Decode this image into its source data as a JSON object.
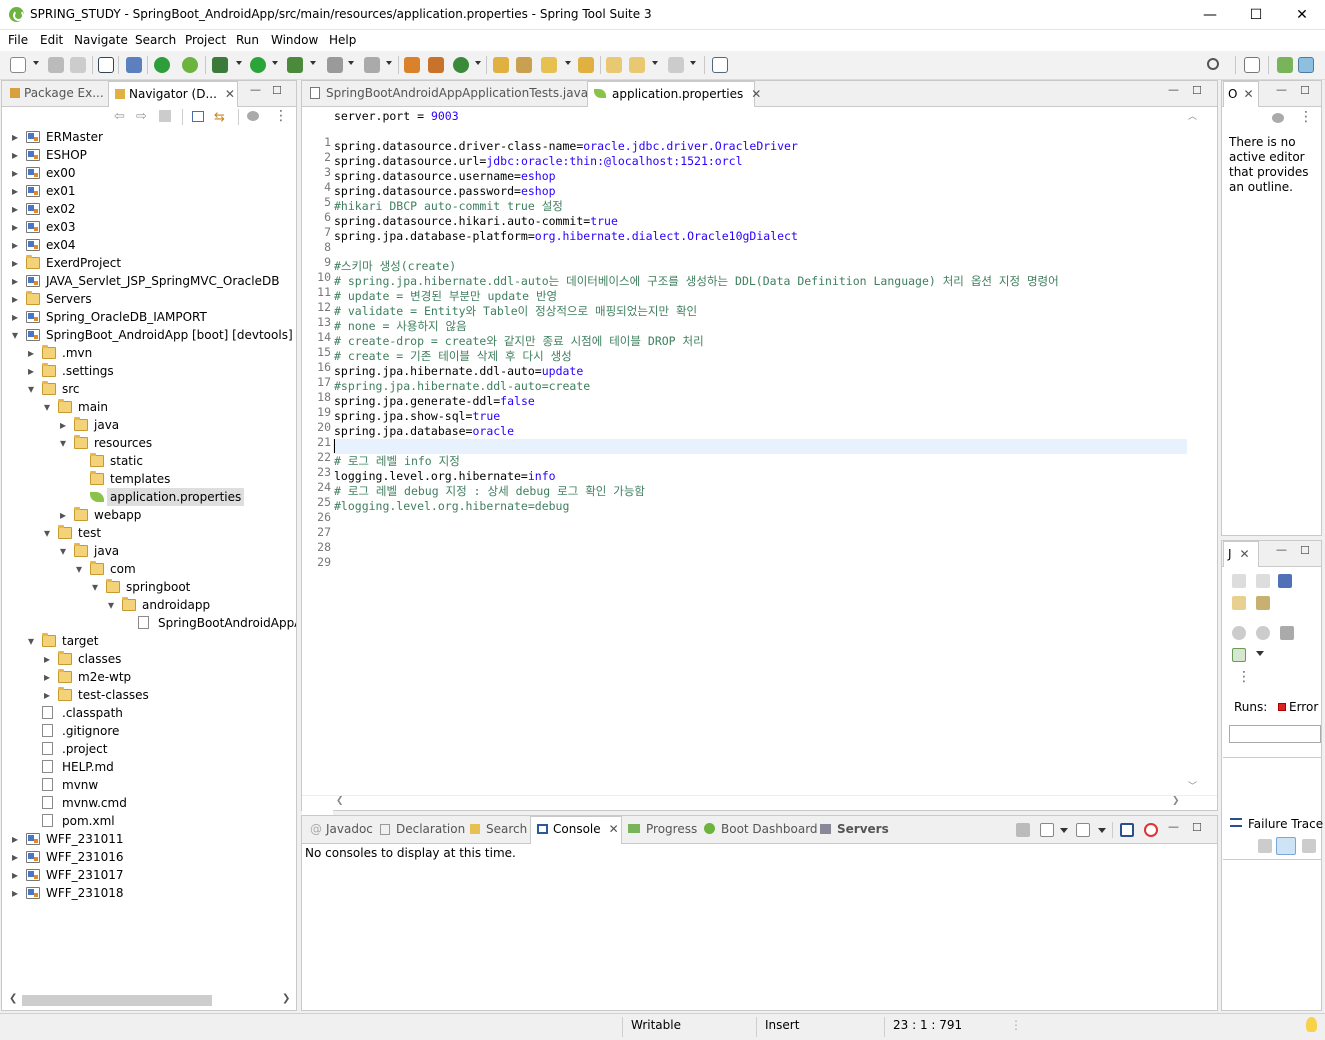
{
  "window": {
    "title": "SPRING_STUDY - SpringBoot_AndroidApp/src/main/resources/application.properties - Spring Tool Suite 3",
    "minimize": "—",
    "maximize": "☐",
    "close": "✕"
  },
  "menu": [
    "File",
    "Edit",
    "Navigate",
    "Search",
    "Project",
    "Run",
    "Window",
    "Help"
  ],
  "left_panel": {
    "tabs": [
      {
        "label": "Package Ex..."
      },
      {
        "label": "Navigator (D..."
      }
    ],
    "tree": [
      {
        "label": "ERMaster",
        "type": "project",
        "depth": 0,
        "toggle": "closed"
      },
      {
        "label": "ESHOP",
        "type": "project",
        "depth": 0,
        "toggle": "closed"
      },
      {
        "label": "ex00",
        "type": "project",
        "depth": 0,
        "toggle": "closed"
      },
      {
        "label": "ex01",
        "type": "project",
        "depth": 0,
        "toggle": "closed"
      },
      {
        "label": "ex02",
        "type": "project",
        "depth": 0,
        "toggle": "closed"
      },
      {
        "label": "ex03",
        "type": "project",
        "depth": 0,
        "toggle": "closed"
      },
      {
        "label": "ex04",
        "type": "project",
        "depth": 0,
        "toggle": "closed"
      },
      {
        "label": "ExerdProject",
        "type": "folder",
        "depth": 0,
        "toggle": "closed"
      },
      {
        "label": "JAVA_Servlet_JSP_SpringMVC_OracleDB",
        "type": "project",
        "depth": 0,
        "toggle": "closed"
      },
      {
        "label": "Servers",
        "type": "folder",
        "depth": 0,
        "toggle": "closed"
      },
      {
        "label": "Spring_OracleDB_IAMPORT",
        "type": "project",
        "depth": 0,
        "toggle": "closed"
      },
      {
        "label": "SpringBoot_AndroidApp [boot] [devtools]",
        "type": "project",
        "depth": 0,
        "toggle": "open"
      },
      {
        "label": ".mvn",
        "type": "folder",
        "depth": 1,
        "toggle": "closed"
      },
      {
        "label": ".settings",
        "type": "folder",
        "depth": 1,
        "toggle": "closed"
      },
      {
        "label": "src",
        "type": "folder",
        "depth": 1,
        "toggle": "open"
      },
      {
        "label": "main",
        "type": "folder",
        "depth": 2,
        "toggle": "open"
      },
      {
        "label": "java",
        "type": "folder",
        "depth": 3,
        "toggle": "closed"
      },
      {
        "label": "resources",
        "type": "folder",
        "depth": 3,
        "toggle": "open"
      },
      {
        "label": "static",
        "type": "folder",
        "depth": 4,
        "toggle": "none"
      },
      {
        "label": "templates",
        "type": "folder",
        "depth": 4,
        "toggle": "none"
      },
      {
        "label": "application.properties",
        "type": "spring",
        "depth": 4,
        "toggle": "none",
        "selected": true
      },
      {
        "label": "webapp",
        "type": "folder",
        "depth": 3,
        "toggle": "closed"
      },
      {
        "label": "test",
        "type": "folder",
        "depth": 2,
        "toggle": "open"
      },
      {
        "label": "java",
        "type": "folder",
        "depth": 3,
        "toggle": "open"
      },
      {
        "label": "com",
        "type": "folder",
        "depth": 4,
        "toggle": "open"
      },
      {
        "label": "springboot",
        "type": "folder",
        "depth": 5,
        "toggle": "open"
      },
      {
        "label": "androidapp",
        "type": "folder",
        "depth": 6,
        "toggle": "open"
      },
      {
        "label": "SpringBootAndroidAppAp",
        "type": "file",
        "depth": 7,
        "toggle": "none"
      },
      {
        "label": "target",
        "type": "folder",
        "depth": 1,
        "toggle": "open"
      },
      {
        "label": "classes",
        "type": "folder",
        "depth": 2,
        "toggle": "closed"
      },
      {
        "label": "m2e-wtp",
        "type": "folder",
        "depth": 2,
        "toggle": "closed"
      },
      {
        "label": "test-classes",
        "type": "folder",
        "depth": 2,
        "toggle": "closed"
      },
      {
        "label": ".classpath",
        "type": "file",
        "depth": 1,
        "toggle": "none"
      },
      {
        "label": ".gitignore",
        "type": "file",
        "depth": 1,
        "toggle": "none"
      },
      {
        "label": ".project",
        "type": "file",
        "depth": 1,
        "toggle": "none"
      },
      {
        "label": "HELP.md",
        "type": "file",
        "depth": 1,
        "toggle": "none"
      },
      {
        "label": "mvnw",
        "type": "file",
        "depth": 1,
        "toggle": "none"
      },
      {
        "label": "mvnw.cmd",
        "type": "file",
        "depth": 1,
        "toggle": "none"
      },
      {
        "label": "pom.xml",
        "type": "file",
        "depth": 1,
        "toggle": "none"
      },
      {
        "label": "WFF_231011",
        "type": "project",
        "depth": 0,
        "toggle": "closed"
      },
      {
        "label": "WFF_231016",
        "type": "project",
        "depth": 0,
        "toggle": "closed"
      },
      {
        "label": "WFF_231017",
        "type": "project",
        "depth": 0,
        "toggle": "closed"
      },
      {
        "label": "WFF_231018",
        "type": "project",
        "depth": 0,
        "toggle": "closed"
      }
    ]
  },
  "editor": {
    "tabs": [
      {
        "label": "SpringBootAndroidAppApplicationTests.java",
        "active": false
      },
      {
        "label": "application.properties",
        "active": true
      }
    ],
    "lines": [
      [
        {
          "t": "server.port = ",
          "c": "k"
        },
        {
          "t": "9003",
          "c": "v"
        }
      ],
      [],
      [
        {
          "t": "spring.datasource.driver-class-name=",
          "c": "k"
        },
        {
          "t": "oracle.jdbc.driver.OracleDriver",
          "c": "v"
        }
      ],
      [
        {
          "t": "spring.datasource.url=",
          "c": "k"
        },
        {
          "t": "jdbc:oracle:thin:@localhost:1521:orcl",
          "c": "v"
        }
      ],
      [
        {
          "t": "spring.datasource.username=",
          "c": "k"
        },
        {
          "t": "eshop",
          "c": "v"
        }
      ],
      [
        {
          "t": "spring.datasource.password=",
          "c": "k"
        },
        {
          "t": "eshop",
          "c": "v"
        }
      ],
      [
        {
          "t": "#hikari DBCP auto-commit true 설정",
          "c": "c"
        }
      ],
      [
        {
          "t": "spring.datasource.hikari.auto-commit=",
          "c": "k"
        },
        {
          "t": "true",
          "c": "v"
        }
      ],
      [
        {
          "t": "spring.jpa.database-platform=",
          "c": "k"
        },
        {
          "t": "org.hibernate.dialect.Oracle10gDialect",
          "c": "v"
        }
      ],
      [],
      [
        {
          "t": "#스키마 생성(create)",
          "c": "c"
        }
      ],
      [
        {
          "t": "# spring.jpa.hibernate.ddl-auto는 데이터베이스에 구조를 생성하는 DDL(Data Definition Language) 처리 옵션 지정 명령어",
          "c": "c"
        }
      ],
      [
        {
          "t": "# update = 변경된 부분만 update 반영",
          "c": "c"
        }
      ],
      [
        {
          "t": "# validate = Entity와 Table이 정상적으로 매핑되었는지만 확인",
          "c": "c"
        }
      ],
      [
        {
          "t": "# none = 사용하지 않음",
          "c": "c"
        }
      ],
      [
        {
          "t": "# create-drop = create와 같지만 종료 시점에 테이블 DROP 처리",
          "c": "c"
        }
      ],
      [
        {
          "t": "# create = 기존 테이블 삭제 후 다시 생성",
          "c": "c"
        }
      ],
      [
        {
          "t": "spring.jpa.hibernate.ddl-auto=",
          "c": "k"
        },
        {
          "t": "update",
          "c": "v"
        }
      ],
      [
        {
          "t": "#spring.jpa.hibernate.ddl-auto=create",
          "c": "c"
        }
      ],
      [
        {
          "t": "spring.jpa.generate-ddl=",
          "c": "k"
        },
        {
          "t": "false",
          "c": "v"
        }
      ],
      [
        {
          "t": "spring.jpa.show-sql=",
          "c": "k"
        },
        {
          "t": "true",
          "c": "v"
        }
      ],
      [
        {
          "t": "spring.jpa.database=",
          "c": "k"
        },
        {
          "t": "oracle",
          "c": "v"
        }
      ],
      [],
      [
        {
          "t": "# 로그 레벨 info 지정",
          "c": "c"
        }
      ],
      [
        {
          "t": "logging.level.org.hibernate=",
          "c": "k"
        },
        {
          "t": "info",
          "c": "v"
        }
      ],
      [
        {
          "t": "# 로그 레벨 debug 지정 : 상세 debug 로그 확인 가능함",
          "c": "c"
        }
      ],
      [
        {
          "t": "#logging.level.org.hibernate=debug",
          "c": "c"
        }
      ],
      [],
      []
    ],
    "current_line": 23
  },
  "outline": {
    "tab": "O",
    "message": "There is no active editor that provides an outline."
  },
  "junit": {
    "tab": "J",
    "runs_label": "Runs:",
    "errors_label": "Error",
    "failure_trace": "Failure Trace"
  },
  "bottom_panel": {
    "tabs": [
      {
        "label": "Javadoc",
        "active": false
      },
      {
        "label": "Declaration",
        "active": false
      },
      {
        "label": "Search",
        "active": false
      },
      {
        "label": "Console",
        "active": true
      },
      {
        "label": "Progress",
        "active": false
      },
      {
        "label": "Boot Dashboard",
        "active": false
      },
      {
        "label": "Servers",
        "active": false
      }
    ],
    "message": "No consoles to display at this time."
  },
  "status": {
    "writable": "Writable",
    "insert": "Insert",
    "position": "23 : 1 : 791"
  },
  "colors": {
    "key": "#000000",
    "value": "#2a00ff",
    "comment": "#3f7f5f",
    "selection": "#dedede",
    "current_line": "#e8f2fe"
  }
}
